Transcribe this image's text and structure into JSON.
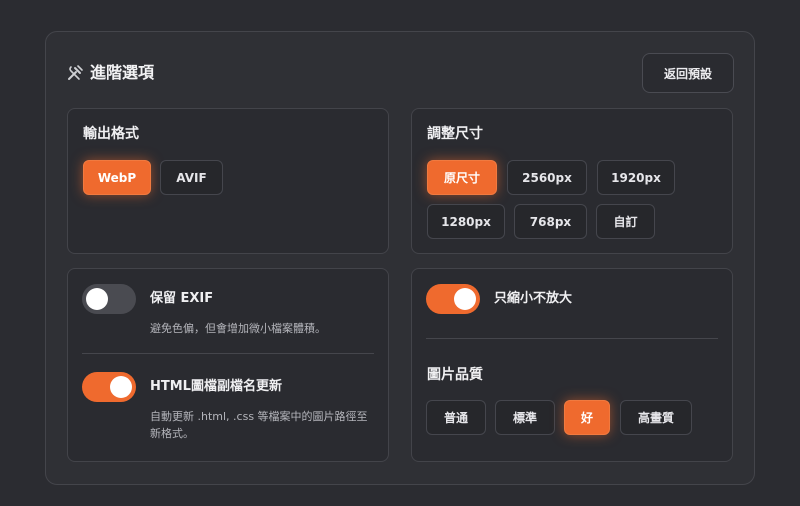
{
  "header": {
    "title": "進階選項",
    "icon": "tools-icon",
    "reset_label": "返回預設"
  },
  "output_format": {
    "title": "輸出格式",
    "options": [
      "WebP",
      "AVIF"
    ],
    "selected": "WebP"
  },
  "resize": {
    "title": "調整尺寸",
    "options": [
      "原尺寸",
      "2560px",
      "1920px",
      "1280px",
      "768px",
      "自訂"
    ],
    "selected": "原尺寸"
  },
  "exif": {
    "label": "保留 EXIF",
    "description": "避免色偏，但會增加微小檔案體積。",
    "enabled": false
  },
  "html_update": {
    "label": "HTML圖檔副檔名更新",
    "description_line1": "自動更新 .html, .css 等檔案中的圖片路徑至",
    "description_line2": "新格式。",
    "enabled": true
  },
  "shrink_only": {
    "label": "只縮小不放大",
    "enabled": true
  },
  "quality": {
    "title": "圖片品質",
    "options": [
      "普通",
      "標準",
      "好",
      "高畫質"
    ],
    "selected": "好"
  },
  "colors": {
    "accent": "#ef6a2e",
    "background": "#2b2c31",
    "card": "#2a2b30"
  }
}
